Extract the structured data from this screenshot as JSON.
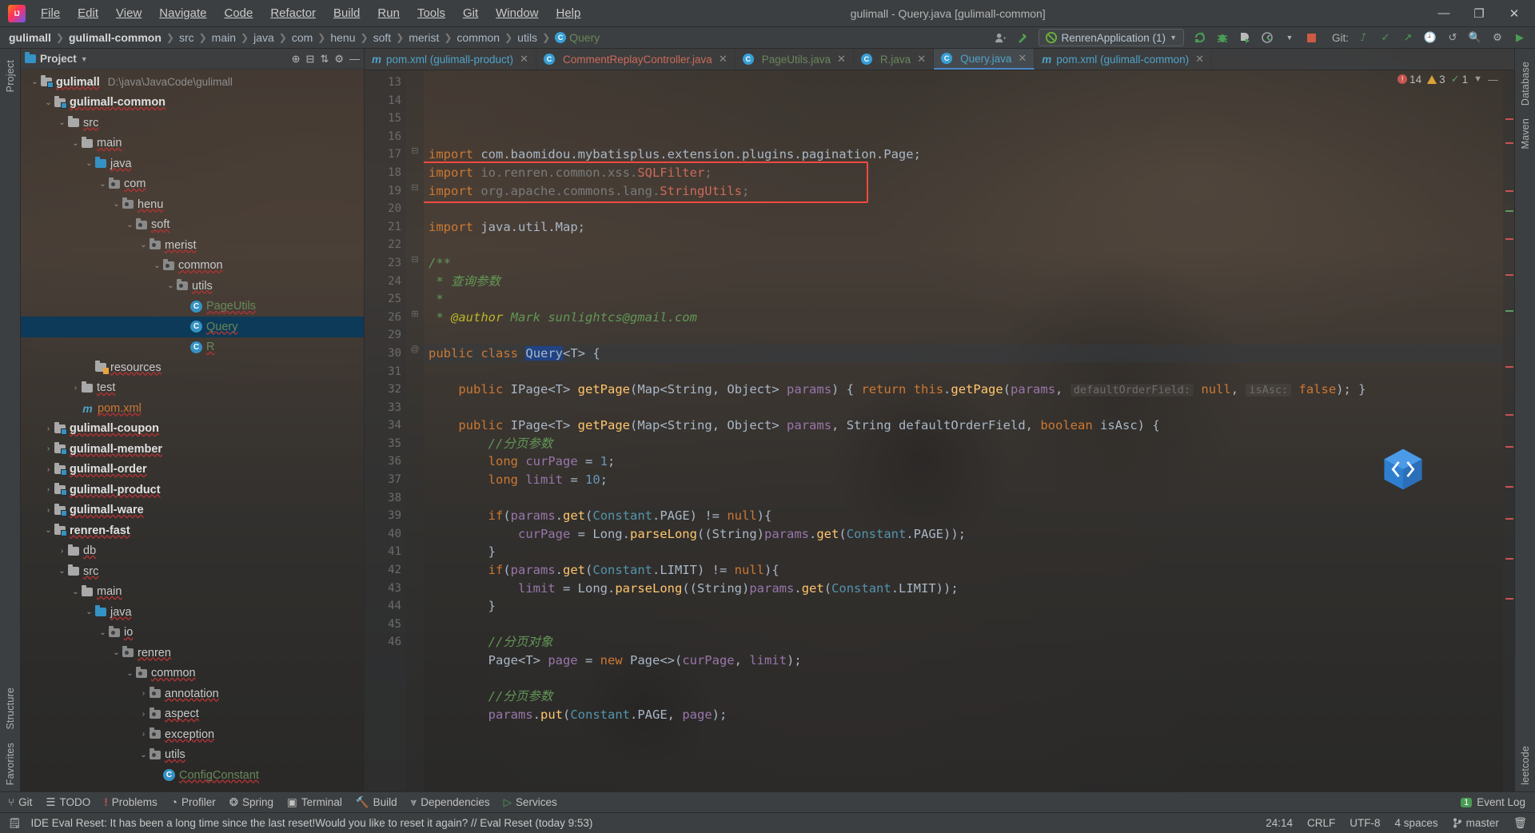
{
  "window": {
    "title": "gulimall - Query.java [gulimall-common]",
    "minimize": "—",
    "maximize": "❐",
    "close": "✕"
  },
  "menu": [
    "File",
    "Edit",
    "View",
    "Navigate",
    "Code",
    "Refactor",
    "Build",
    "Run",
    "Tools",
    "Git",
    "Window",
    "Help"
  ],
  "breadcrumb": [
    {
      "label": "gulimall",
      "bold": true
    },
    {
      "label": "gulimall-common",
      "bold": true
    },
    {
      "label": "src"
    },
    {
      "label": "main"
    },
    {
      "label": "java"
    },
    {
      "label": "com"
    },
    {
      "label": "henu"
    },
    {
      "label": "soft"
    },
    {
      "label": "merist"
    },
    {
      "label": "common"
    },
    {
      "label": "utils"
    },
    {
      "label": "Query",
      "green": true,
      "icon": "class-icon"
    }
  ],
  "toolbar": {
    "run_config": "RenrenApplication (1)",
    "git_label": "Git:",
    "icons": [
      "profile-icon",
      "hammer-build-icon",
      "rerun-icon",
      "debug-icon",
      "run-with-coverage-icon",
      "profiler-icon",
      "stop-icon",
      "git-update-icon",
      "git-commit-icon",
      "git-push-icon",
      "git-history-icon",
      "undo-icon",
      "search-everywhere-icon",
      "settings-icon",
      "run-icon"
    ]
  },
  "tool_windows_left": [
    "Project",
    "Structure",
    "Favorites"
  ],
  "tool_windows_right": [
    "Database",
    "Maven",
    "leetcode"
  ],
  "project_panel": {
    "title": "Project",
    "actions": [
      "expand-icon",
      "collapse-icon",
      "sort-icon",
      "settings-icon",
      "hide-icon"
    ],
    "tree": [
      {
        "depth": 0,
        "arrow": "down",
        "icon": "module-folder",
        "label": "gulimall",
        "bold": true,
        "path": "D:\\java\\JavaCode\\gulimall"
      },
      {
        "depth": 1,
        "arrow": "down",
        "icon": "module-folder",
        "label": "gulimall-common",
        "bold": true
      },
      {
        "depth": 2,
        "arrow": "down",
        "icon": "folder",
        "label": "src"
      },
      {
        "depth": 3,
        "arrow": "down",
        "icon": "folder",
        "label": "main"
      },
      {
        "depth": 4,
        "arrow": "down",
        "icon": "source-folder",
        "label": "java"
      },
      {
        "depth": 5,
        "arrow": "down",
        "icon": "package",
        "label": "com"
      },
      {
        "depth": 6,
        "arrow": "down",
        "icon": "package",
        "label": "henu"
      },
      {
        "depth": 7,
        "arrow": "down",
        "icon": "package",
        "label": "soft"
      },
      {
        "depth": 8,
        "arrow": "down",
        "icon": "package",
        "label": "merist"
      },
      {
        "depth": 9,
        "arrow": "down",
        "icon": "package",
        "label": "common"
      },
      {
        "depth": 10,
        "arrow": "down",
        "icon": "package",
        "label": "utils"
      },
      {
        "depth": 11,
        "arrow": "none",
        "icon": "class",
        "label": "PageUtils",
        "green": true
      },
      {
        "depth": 11,
        "arrow": "none",
        "icon": "class",
        "label": "Query",
        "green": true,
        "selected": true
      },
      {
        "depth": 11,
        "arrow": "none",
        "icon": "class",
        "label": "R",
        "green": true
      },
      {
        "depth": 4,
        "arrow": "none",
        "icon": "resource-folder",
        "label": "resources"
      },
      {
        "depth": 3,
        "arrow": "right",
        "icon": "folder",
        "label": "test"
      },
      {
        "depth": 3,
        "arrow": "none",
        "icon": "maven",
        "label": "pom.xml",
        "orange": true
      },
      {
        "depth": 1,
        "arrow": "right",
        "icon": "module-folder",
        "label": "gulimall-coupon",
        "bold": true
      },
      {
        "depth": 1,
        "arrow": "right",
        "icon": "module-folder",
        "label": "gulimall-member",
        "bold": true
      },
      {
        "depth": 1,
        "arrow": "right",
        "icon": "module-folder",
        "label": "gulimall-order",
        "bold": true
      },
      {
        "depth": 1,
        "arrow": "right",
        "icon": "module-folder",
        "label": "gulimall-product",
        "bold": true
      },
      {
        "depth": 1,
        "arrow": "right",
        "icon": "module-folder",
        "label": "gulimall-ware",
        "bold": true
      },
      {
        "depth": 1,
        "arrow": "down",
        "icon": "module-folder",
        "label": "renren-fast",
        "bold": true
      },
      {
        "depth": 2,
        "arrow": "right",
        "icon": "folder",
        "label": "db"
      },
      {
        "depth": 2,
        "arrow": "down",
        "icon": "folder",
        "label": "src"
      },
      {
        "depth": 3,
        "arrow": "down",
        "icon": "folder",
        "label": "main"
      },
      {
        "depth": 4,
        "arrow": "down",
        "icon": "source-folder",
        "label": "java"
      },
      {
        "depth": 5,
        "arrow": "down",
        "icon": "package",
        "label": "io"
      },
      {
        "depth": 6,
        "arrow": "down",
        "icon": "package",
        "label": "renren"
      },
      {
        "depth": 7,
        "arrow": "down",
        "icon": "package",
        "label": "common"
      },
      {
        "depth": 8,
        "arrow": "right",
        "icon": "package",
        "label": "annotation"
      },
      {
        "depth": 8,
        "arrow": "right",
        "icon": "package",
        "label": "aspect"
      },
      {
        "depth": 8,
        "arrow": "right",
        "icon": "package",
        "label": "exception"
      },
      {
        "depth": 8,
        "arrow": "down",
        "icon": "package",
        "label": "utils"
      },
      {
        "depth": 9,
        "arrow": "none",
        "icon": "class",
        "label": "ConfigConstant",
        "green": true
      }
    ]
  },
  "editor": {
    "tabs": [
      {
        "label": "pom.xml (gulimall-product)",
        "icon": "maven-icon",
        "color": "cyan",
        "active": false
      },
      {
        "label": "CommentReplayController.java",
        "icon": "class-icon",
        "color": "red",
        "active": false
      },
      {
        "label": "PageUtils.java",
        "icon": "class-icon",
        "color": "green",
        "active": false
      },
      {
        "label": "R.java",
        "icon": "class-icon",
        "color": "green",
        "active": false
      },
      {
        "label": "Query.java",
        "icon": "class-icon",
        "color": "cyan",
        "active": true
      },
      {
        "label": "pom.xml (gulimall-common)",
        "icon": "maven-icon",
        "color": "cyan",
        "active": false
      }
    ],
    "inspections": {
      "errors": "14",
      "warnings": "3",
      "weak_warnings": "1"
    },
    "first_line_number": 13,
    "lines": [
      {
        "n": "13",
        "text": "import com.baomidou.mybatisplus.extension.plugins.pagination.Page;"
      },
      {
        "n": "14",
        "text": "import io.renren.common.xss.SQLFilter;"
      },
      {
        "n": "15",
        "text": "import org.apache.commons.lang.StringUtils;"
      },
      {
        "n": "16",
        "text": ""
      },
      {
        "n": "17",
        "text": "import java.util.Map;"
      },
      {
        "n": "18",
        "text": ""
      },
      {
        "n": "19",
        "text": "/**"
      },
      {
        "n": "20",
        "text": " * 查询参数"
      },
      {
        "n": "21",
        "text": " *"
      },
      {
        "n": "22",
        "text": " * @author Mark sunlightcs@gmail.com"
      },
      {
        "n": "23",
        "text": ""
      },
      {
        "n": "24",
        "text": "public class Query<T> {"
      },
      {
        "n": "25",
        "text": ""
      },
      {
        "n": "26",
        "text": "    public IPage<T> getPage(Map<String, Object> params) { return this.getPage(params, defaultOrderField: null, isAsc: false); }"
      },
      {
        "n": "29",
        "text": ""
      },
      {
        "n": "30",
        "text": "    public IPage<T> getPage(Map<String, Object> params, String defaultOrderField, boolean isAsc) {"
      },
      {
        "n": "31",
        "text": "        //分页参数"
      },
      {
        "n": "32",
        "text": "        long curPage = 1;"
      },
      {
        "n": "33",
        "text": "        long limit = 10;"
      },
      {
        "n": "34",
        "text": ""
      },
      {
        "n": "35",
        "text": "        if(params.get(Constant.PAGE) != null){"
      },
      {
        "n": "36",
        "text": "            curPage = Long.parseLong((String)params.get(Constant.PAGE));"
      },
      {
        "n": "37",
        "text": "        }"
      },
      {
        "n": "38",
        "text": "        if(params.get(Constant.LIMIT) != null){"
      },
      {
        "n": "39",
        "text": "            limit = Long.parseLong((String)params.get(Constant.LIMIT));"
      },
      {
        "n": "40",
        "text": "        }"
      },
      {
        "n": "41",
        "text": ""
      },
      {
        "n": "42",
        "text": "        //分页对象"
      },
      {
        "n": "43",
        "text": "        Page<T> page = new Page<>(curPage, limit);"
      },
      {
        "n": "44",
        "text": ""
      },
      {
        "n": "45",
        "text": "        //分页参数"
      },
      {
        "n": "46",
        "text": "        params.put(Constant.PAGE, page);"
      }
    ],
    "highlight_note": "red rectangle around lines 14-15 imports"
  },
  "bottom_tools": [
    {
      "label": "Git",
      "icon": "git-icon"
    },
    {
      "label": "TODO",
      "icon": "todo-icon"
    },
    {
      "label": "Problems",
      "icon": "problems-icon"
    },
    {
      "label": "Profiler",
      "icon": "profiler-icon"
    },
    {
      "label": "Spring",
      "icon": "spring-icon"
    },
    {
      "label": "Terminal",
      "icon": "terminal-icon"
    },
    {
      "label": "Build",
      "icon": "build-icon"
    },
    {
      "label": "Dependencies",
      "icon": "dependencies-icon"
    },
    {
      "label": "Services",
      "icon": "services-icon"
    }
  ],
  "event_log": {
    "label": "Event Log",
    "count": "1"
  },
  "status_bar": {
    "message": "IDE Eval Reset: It has been a long time since the last reset!Would you like to reset it again? // Eval Reset (today 9:53)",
    "caret": "24:14",
    "line_sep": "CRLF",
    "encoding": "UTF-8",
    "indent": "4 spaces",
    "branch": "master"
  },
  "colors": {
    "accent_blue": "#3592c4",
    "green": "#499c54",
    "error_red": "#c75450",
    "warn_yellow": "#d9a336",
    "selection": "#0d3a58",
    "highlight_box": "#f04a3f"
  }
}
